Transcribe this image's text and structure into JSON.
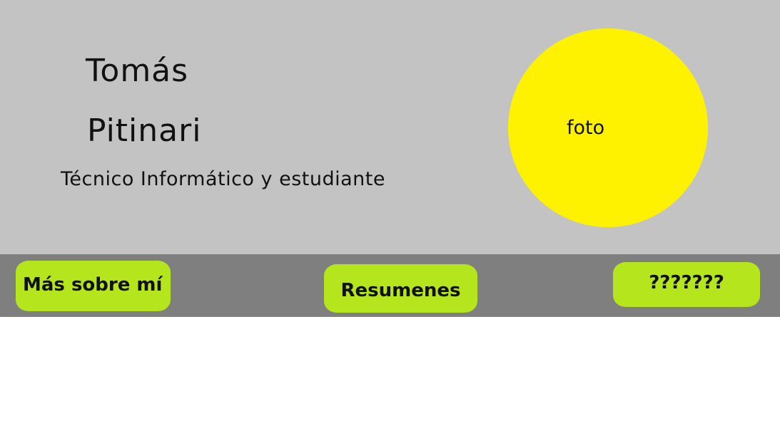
{
  "header": {
    "first_name": "Tomás",
    "last_name": "Pitinari",
    "subtitle": "Técnico Informático y estudiante",
    "photo_label": "foto"
  },
  "nav": {
    "about_label": "Más sobre mí",
    "summaries_label": "Resumenes",
    "unknown_label": "???????"
  },
  "colors": {
    "header_bg": "#c3c3c3",
    "nav_bg": "#7f7f7f",
    "button_bg": "#b5e61d",
    "photo_bg": "#fff200"
  }
}
